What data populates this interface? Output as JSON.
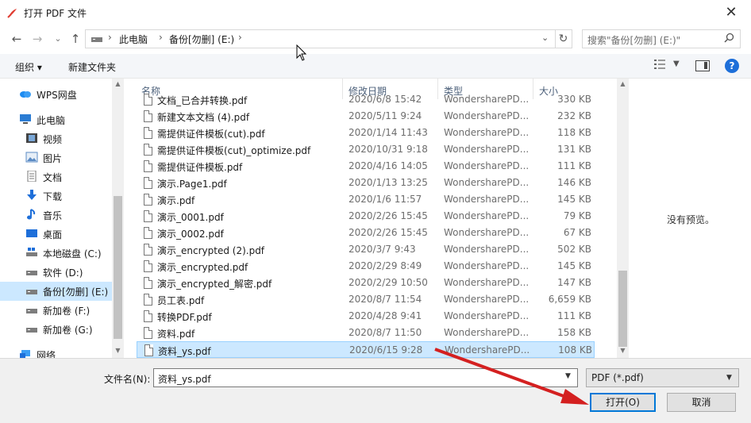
{
  "window": {
    "title": "打开 PDF 文件",
    "close_glyph": "✕"
  },
  "nav": {
    "back": "←",
    "forward": "→",
    "recent": "⌄",
    "up": "↑"
  },
  "address": {
    "crumbs": [
      "此电脑",
      "备份[勿删] (E:)"
    ],
    "sep": "›",
    "dropdown": "⌄",
    "refresh": "↻"
  },
  "search": {
    "placeholder": "搜索\"备份[勿删] (E:)\"",
    "icon": "search-icon"
  },
  "toolbar": {
    "organize": "组织 ▾",
    "new_folder": "新建文件夹",
    "help": "?"
  },
  "sidebar": {
    "items": [
      {
        "label": "WPS网盘",
        "icon": "cloud-icon"
      },
      {
        "label": "此电脑",
        "icon": "computer-icon"
      },
      {
        "label": "视频",
        "icon": "video-icon"
      },
      {
        "label": "图片",
        "icon": "picture-icon"
      },
      {
        "label": "文档",
        "icon": "document-icon"
      },
      {
        "label": "下载",
        "icon": "download-icon"
      },
      {
        "label": "音乐",
        "icon": "music-icon"
      },
      {
        "label": "桌面",
        "icon": "desktop-icon"
      },
      {
        "label": "本地磁盘 (C:)",
        "icon": "drive-icon"
      },
      {
        "label": "软件 (D:)",
        "icon": "drive-icon"
      },
      {
        "label": "备份[勿删] (E:)",
        "icon": "drive-icon",
        "selected": true
      },
      {
        "label": "新加卷 (F:)",
        "icon": "drive-icon"
      },
      {
        "label": "新加卷 (G:)",
        "icon": "drive-icon"
      },
      {
        "label": "网络",
        "icon": "network-icon"
      }
    ]
  },
  "columns": {
    "name": "名称",
    "date": "修改日期",
    "type": "类型",
    "size": "大小"
  },
  "files": [
    {
      "name": "文档_已合并转换.pdf",
      "date": "2020/6/8 15:42",
      "type": "WondersharePD...",
      "size": "330 KB"
    },
    {
      "name": "新建文本文档 (4).pdf",
      "date": "2020/5/11 9:24",
      "type": "WondersharePD...",
      "size": "232 KB"
    },
    {
      "name": "需提供证件模板(cut).pdf",
      "date": "2020/1/14 11:43",
      "type": "WondersharePD...",
      "size": "118 KB"
    },
    {
      "name": "需提供证件模板(cut)_optimize.pdf",
      "date": "2020/10/31 9:18",
      "type": "WondersharePD...",
      "size": "131 KB"
    },
    {
      "name": "需提供证件模板.pdf",
      "date": "2020/4/16 14:05",
      "type": "WondersharePD...",
      "size": "111 KB"
    },
    {
      "name": "演示.Page1.pdf",
      "date": "2020/1/13 13:25",
      "type": "WondersharePD...",
      "size": "146 KB"
    },
    {
      "name": "演示.pdf",
      "date": "2020/1/6 11:57",
      "type": "WondersharePD...",
      "size": "145 KB"
    },
    {
      "name": "演示_0001.pdf",
      "date": "2020/2/26 15:45",
      "type": "WondersharePD...",
      "size": "79 KB"
    },
    {
      "name": "演示_0002.pdf",
      "date": "2020/2/26 15:45",
      "type": "WondersharePD...",
      "size": "67 KB"
    },
    {
      "name": "演示_encrypted (2).pdf",
      "date": "2020/3/7 9:43",
      "type": "WondersharePD...",
      "size": "502 KB"
    },
    {
      "name": "演示_encrypted.pdf",
      "date": "2020/2/29 8:49",
      "type": "WondersharePD...",
      "size": "145 KB"
    },
    {
      "name": "演示_encrypted_解密.pdf",
      "date": "2020/2/29 10:50",
      "type": "WondersharePD...",
      "size": "147 KB"
    },
    {
      "name": "员工表.pdf",
      "date": "2020/8/7 11:54",
      "type": "WondersharePD...",
      "size": "6,659 KB"
    },
    {
      "name": "转换PDF.pdf",
      "date": "2020/4/28 9:41",
      "type": "WondersharePD...",
      "size": "111 KB"
    },
    {
      "name": "资料.pdf",
      "date": "2020/8/7 11:50",
      "type": "WondersharePD...",
      "size": "158 KB"
    },
    {
      "name": "资料_ys.pdf",
      "date": "2020/6/15 9:28",
      "type": "WondersharePD...",
      "size": "108 KB",
      "selected": true
    }
  ],
  "preview": {
    "message": "没有预览。"
  },
  "footer": {
    "filename_label": "文件名(N):",
    "filename_value": "资料_ys.pdf",
    "filetype": "PDF (*.pdf)",
    "open": "打开(O)",
    "cancel": "取消"
  },
  "colors": {
    "selection": "#cce8ff",
    "accent": "#0078d7",
    "annotation_arrow": "#d42020"
  }
}
